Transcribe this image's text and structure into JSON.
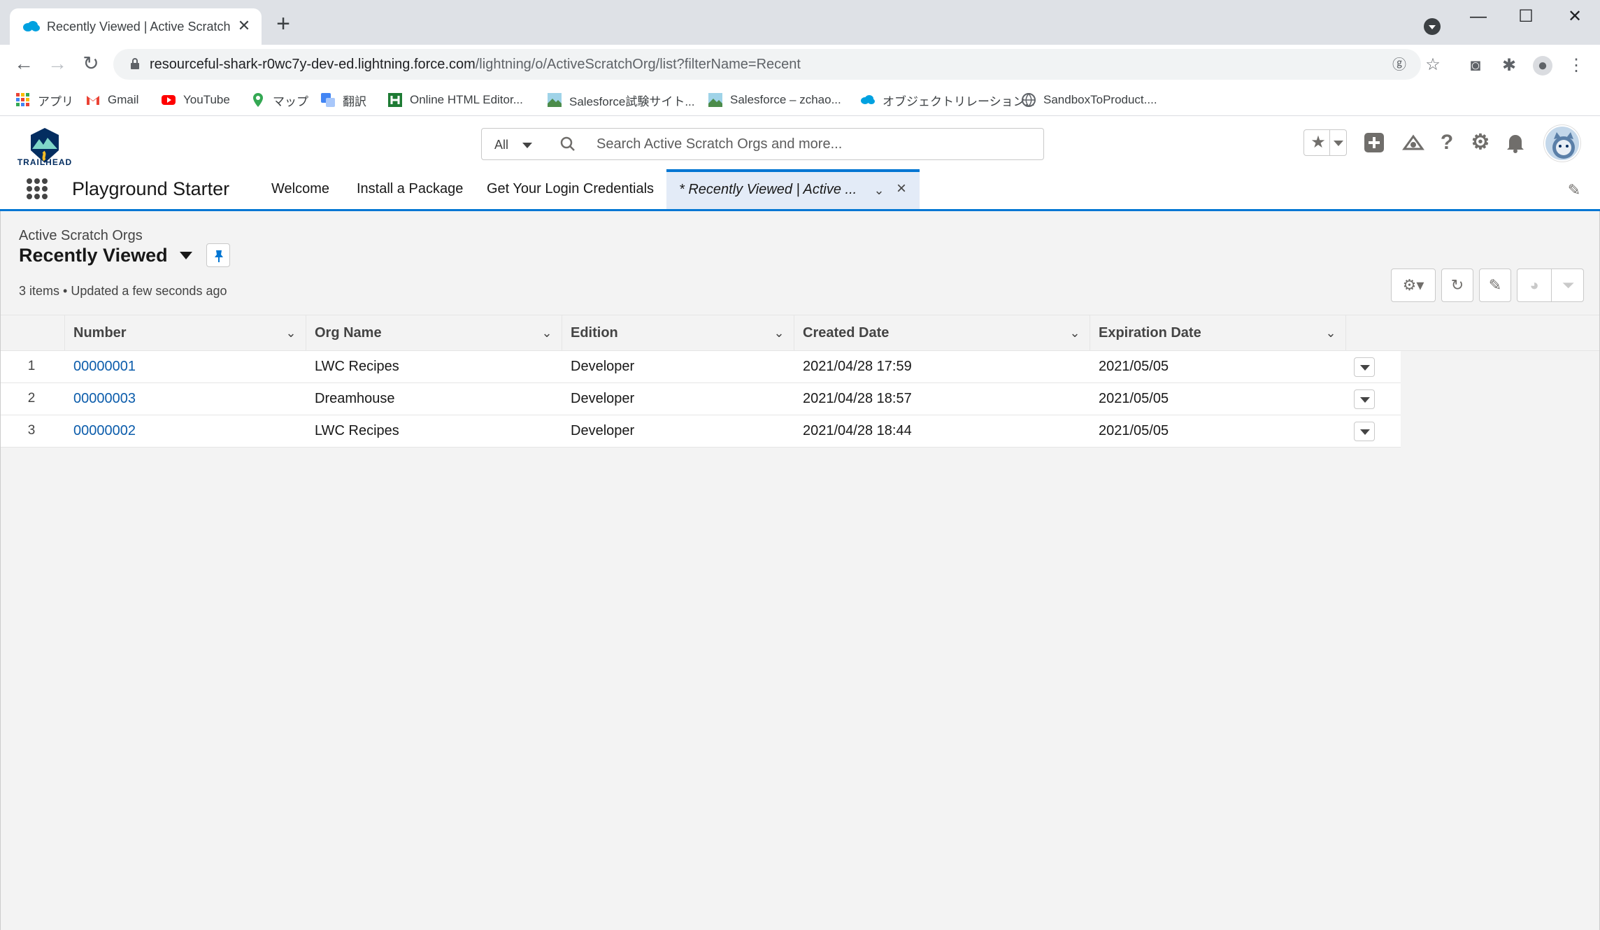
{
  "browser": {
    "tab_title": "Recently Viewed | Active Scratch",
    "tab_close": "✕",
    "new_tab": "+",
    "url_host": "resourceful-shark-r0wc7y-dev-ed.lightning.force.com",
    "url_path": "/lightning/o/ActiveScratchOrg/list?filterName=Recent",
    "bookmarks": [
      {
        "label": "アプリ",
        "icon": "apps-grid-icon",
        "color": "#ea4335"
      },
      {
        "label": "Gmail",
        "icon": "gmail-icon",
        "color": "#ea4335"
      },
      {
        "label": "YouTube",
        "icon": "youtube-icon",
        "color": "#ff0000"
      },
      {
        "label": "マップ",
        "icon": "maps-icon",
        "color": "#34a853"
      },
      {
        "label": "翻訳",
        "icon": "translate-icon",
        "color": "#4285f4"
      },
      {
        "label": "Online HTML Editor...",
        "icon": "html-editor-icon",
        "color": "#1e7b34"
      },
      {
        "label": "Salesforce試験サイト...",
        "icon": "site-icon",
        "color": "#4c8c4a"
      },
      {
        "label": "Salesforce – zchao...",
        "icon": "site-icon",
        "color": "#4c8c4a"
      },
      {
        "label": "オブジェクトリレーション...",
        "icon": "salesforce-cloud-icon",
        "color": "#00a1e0"
      },
      {
        "label": "SandboxToProduct....",
        "icon": "globe-icon",
        "color": "#5f6368"
      }
    ]
  },
  "sf": {
    "logo_text": "TRAILHEAD",
    "search_scope": "All",
    "search_placeholder": "Search Active Scratch Orgs and more...",
    "app_name": "Playground Starter",
    "nav_tabs": [
      "Welcome",
      "Install a Package",
      "Get Your Login Credentials"
    ],
    "active_tab": "* Recently Viewed | Active ...",
    "accent": "#0176d3"
  },
  "list": {
    "object_label": "Active Scratch Orgs",
    "title": "Recently Viewed",
    "info": "3 items • Updated a few seconds ago",
    "columns": [
      "Number",
      "Org Name",
      "Edition",
      "Created Date",
      "Expiration Date"
    ],
    "rows": [
      {
        "index": "1",
        "number": "00000001",
        "org_name": "LWC Recipes",
        "edition": "Developer",
        "created": "2021/04/28 17:59",
        "expiration": "2021/05/05"
      },
      {
        "index": "2",
        "number": "00000003",
        "org_name": "Dreamhouse",
        "edition": "Developer",
        "created": "2021/04/28 18:57",
        "expiration": "2021/05/05"
      },
      {
        "index": "3",
        "number": "00000002",
        "org_name": "LWC Recipes",
        "edition": "Developer",
        "created": "2021/04/28 18:44",
        "expiration": "2021/05/05"
      }
    ]
  }
}
